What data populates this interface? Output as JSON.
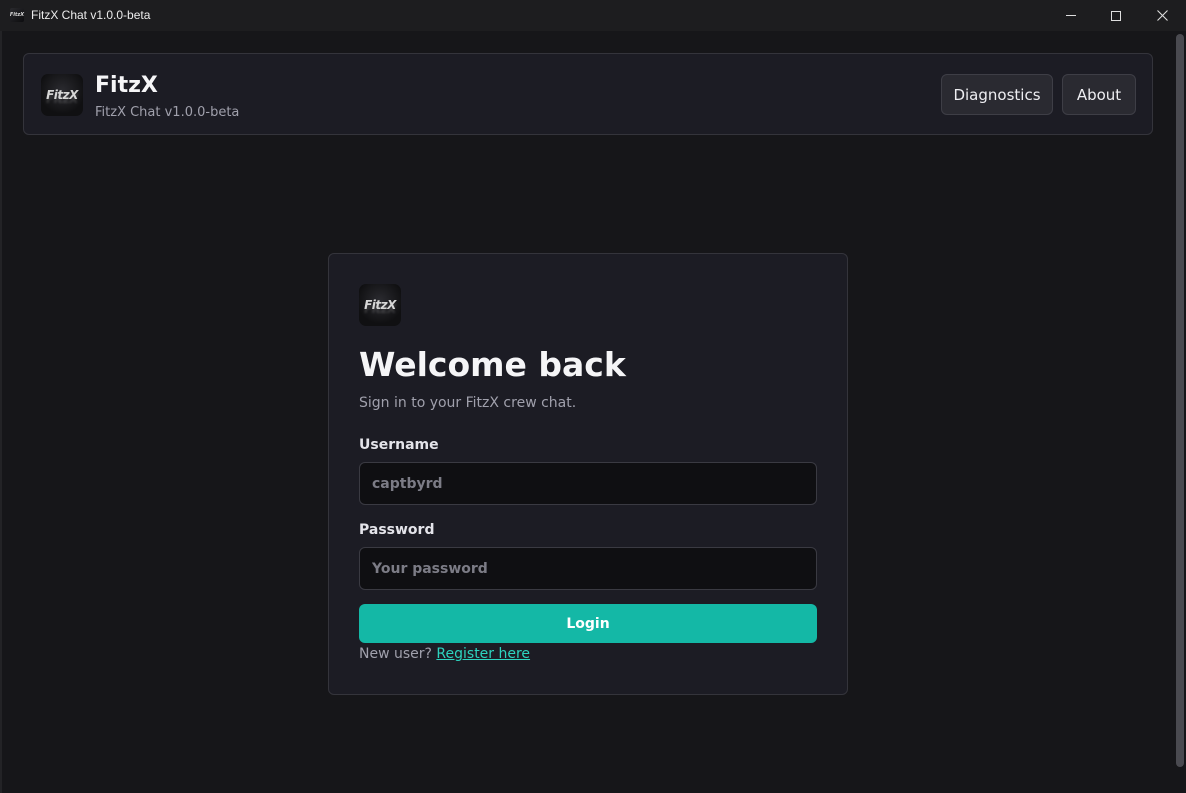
{
  "window": {
    "title": "FitzX Chat v1.0.0-beta",
    "icon_text": "FitzX"
  },
  "header": {
    "logo_text": "FitzX",
    "brand_name": "FitzX",
    "version": "FitzX Chat v1.0.0-beta",
    "buttons": {
      "diagnostics": "Diagnostics",
      "about": "About"
    }
  },
  "login": {
    "logo_text": "FitzX",
    "title": "Welcome back",
    "subtitle": "Sign in to your FitzX crew chat.",
    "username_label": "Username",
    "username_placeholder": "captbyrd",
    "password_label": "Password",
    "password_placeholder": "Your password",
    "login_label": "Login",
    "new_user_text": "New user? ",
    "register_link": "Register here"
  },
  "icons": {
    "minimize": "minimize-icon",
    "maximize": "maximize-icon",
    "close": "close-icon"
  },
  "colors": {
    "accent": "#14b8a6",
    "link": "#2dd4bf",
    "background": "#161619",
    "card": "#1c1c24"
  }
}
